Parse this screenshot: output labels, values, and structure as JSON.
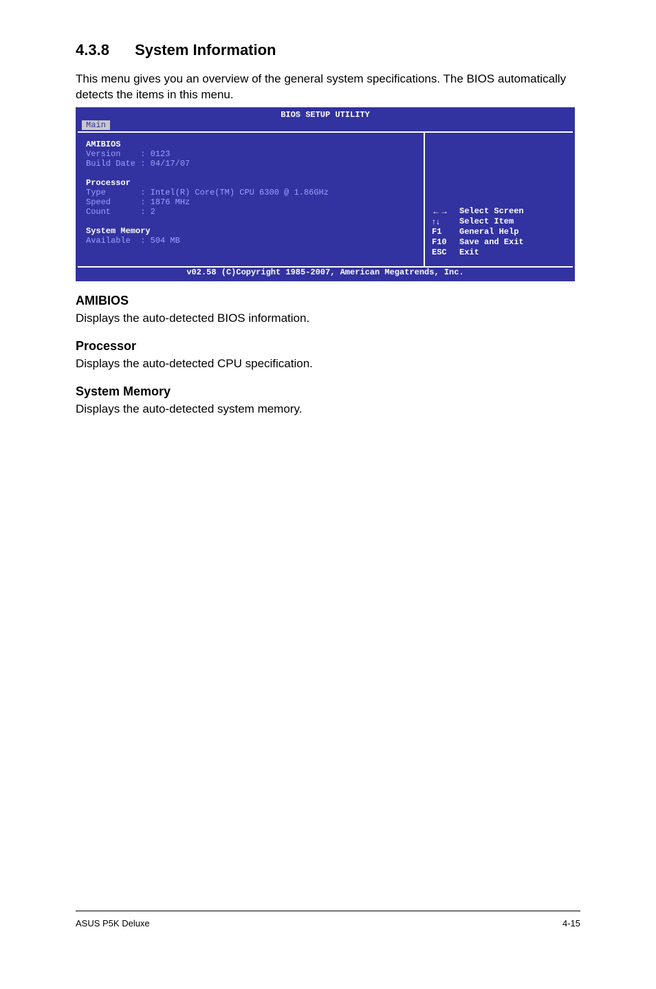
{
  "section": {
    "number": "4.3.8",
    "title": "System Information"
  },
  "intro": "This menu gives you an overview of the general system specifications. The BIOS automatically detects the items in this menu.",
  "bios": {
    "title": "BIOS SETUP UTILITY",
    "tab": "Main",
    "amibios": {
      "heading": "AMIBIOS",
      "version_key": "Version    :",
      "version_val": " 0123",
      "build_key": "Build Date :",
      "build_val": " 04/17/07"
    },
    "processor": {
      "heading": "Processor",
      "type_key": "Type       :",
      "type_val": " Intel(R) Core(TM) CPU 6300 @ 1.86GHz",
      "speed_key": "Speed      :",
      "speed_val": " 1876 MHz",
      "count_key": "Count      :",
      "count_val": " 2"
    },
    "memory": {
      "heading": "System Memory",
      "avail_key": "Available  :",
      "avail_val": " 504 MB"
    },
    "legend": [
      {
        "key": "←→",
        "label": "Select Screen"
      },
      {
        "key": "↑↓",
        "label": "Select Item"
      },
      {
        "key": "F1",
        "label": "General Help"
      },
      {
        "key": "F10",
        "label": "Save and Exit"
      },
      {
        "key": "ESC",
        "label": "Exit"
      }
    ],
    "footer": "v02.58 (C)Copyright 1985-2007, American Megatrends, Inc."
  },
  "subsections": [
    {
      "title": "AMIBIOS",
      "text": "Displays the auto-detected BIOS information."
    },
    {
      "title": "Processor",
      "text": "Displays the auto-detected CPU specification."
    },
    {
      "title": "System Memory",
      "text": "Displays the auto-detected system memory."
    }
  ],
  "pagefooter": {
    "left": "ASUS P5K Deluxe",
    "right": "4-15"
  }
}
